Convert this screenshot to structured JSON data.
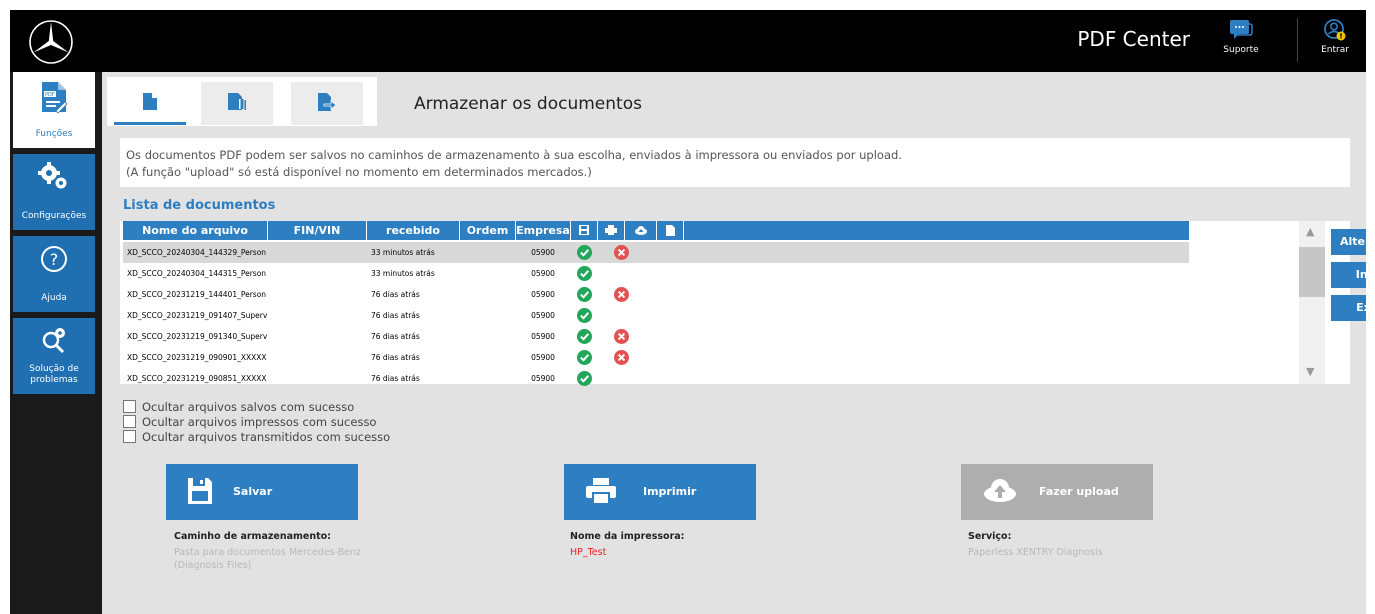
{
  "app": {
    "title": "PDF Center"
  },
  "topbar": {
    "support_label": "Suporte",
    "login_label": "Entrar"
  },
  "sidebar": {
    "items": [
      {
        "label": "Funções",
        "icon": "pdf-document-icon",
        "active": true
      },
      {
        "label": "Configurações",
        "icon": "gears-icon",
        "active": false
      },
      {
        "label": "Ajuda",
        "icon": "help-icon",
        "active": false
      },
      {
        "label": "Solução de problemas",
        "icon": "troubleshoot-gears-icon",
        "active": false
      }
    ]
  },
  "tabs": [
    {
      "icon": "document-icon",
      "active": true
    },
    {
      "icon": "documents-icon",
      "active": false
    },
    {
      "icon": "document-export-icon",
      "active": false
    }
  ],
  "page": {
    "title": "Armazenar os documentos",
    "info_line1": "Os documentos PDF podem ser salvos no caminhos de armazenamento à sua escolha, enviados à impressora ou enviados por upload.",
    "info_line2": "(A função \"upload\" só está disponível no momento em determinados mercados.)"
  },
  "list": {
    "title": "Lista de documentos",
    "columns": [
      "Nome do arquivo",
      "FIN/VIN",
      "recebido",
      "Ordem de",
      "Empresa"
    ],
    "icon_columns": [
      "save-icon",
      "print-icon",
      "upload-icon",
      "document-icon"
    ],
    "rows": [
      {
        "name": "XD_SCCO_20240304_144329_Person",
        "vin": "",
        "received": "33 minutos atrás",
        "order": "",
        "company": "05900",
        "saved": "ok",
        "printed": "error",
        "selected": true
      },
      {
        "name": "XD_SCCO_20240304_144315_Person",
        "vin": "",
        "received": "33 minutos atrás",
        "order": "",
        "company": "05900",
        "saved": "ok",
        "printed": "",
        "selected": false
      },
      {
        "name": "XD_SCCO_20231219_144401_Person",
        "vin": "",
        "received": "76 dias atrás",
        "order": "",
        "company": "05900",
        "saved": "ok",
        "printed": "error",
        "selected": false
      },
      {
        "name": "XD_SCCO_20231219_091407_Superv",
        "vin": "",
        "received": "76 dias atrás",
        "order": "",
        "company": "05900",
        "saved": "ok",
        "printed": "",
        "selected": false
      },
      {
        "name": "XD_SCCO_20231219_091340_Superv",
        "vin": "",
        "received": "76 dias atrás",
        "order": "",
        "company": "05900",
        "saved": "ok",
        "printed": "error",
        "selected": false
      },
      {
        "name": "XD_SCCO_20231219_090901_XXXXX",
        "vin": "",
        "received": "76 dias atrás",
        "order": "",
        "company": "05900",
        "saved": "ok",
        "printed": "error",
        "selected": false
      },
      {
        "name": "XD_SCCO_20231219_090851_XXXXX",
        "vin": "",
        "received": "76 dias atrás",
        "order": "",
        "company": "05900",
        "saved": "ok",
        "printed": "",
        "selected": false
      }
    ],
    "side_buttons": [
      "Alterar atributos",
      "Inserir nota",
      "Exibir erros"
    ]
  },
  "filters": [
    {
      "label": "Ocultar arquivos salvos com sucesso",
      "checked": false
    },
    {
      "label": "Ocultar arquivos impressos com sucesso",
      "checked": false
    },
    {
      "label": "Ocultar arquivos transmitidos com sucesso",
      "checked": false
    }
  ],
  "actions": {
    "save": {
      "label": "Salvar",
      "heading": "Caminho de armazenamento:",
      "value": "Pasta para documentos Mercedes-Benz (Diagnosis Files)"
    },
    "print": {
      "label": "Imprimir",
      "heading": "Nome da impressora:",
      "value": "HP_Test"
    },
    "upload": {
      "label": "Fazer upload",
      "heading": "Serviço:",
      "value": "Paperless XENTRY Diagnosis",
      "enabled": false
    }
  },
  "colors": {
    "accent": "#2d7fc1",
    "ok": "#21a65a",
    "error": "#e25252",
    "disabled": "#aeaeae"
  }
}
